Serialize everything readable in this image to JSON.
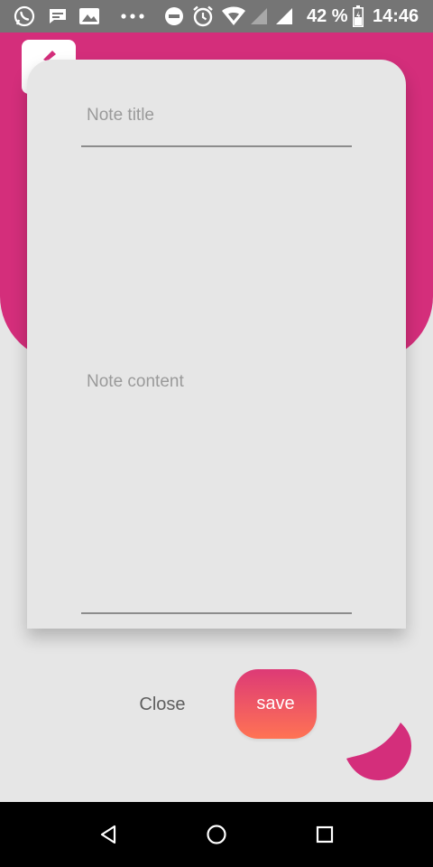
{
  "status_bar": {
    "icons": [
      "whatsapp-icon",
      "message-icon",
      "image-icon",
      "more-icon",
      "do-not-disturb-icon",
      "alarm-icon",
      "wifi-icon",
      "signal-icon",
      "signal-icon",
      "battery-icon"
    ],
    "battery": "42 %",
    "time": "14:46"
  },
  "header": {
    "color": "#d42e7b",
    "logo_icon": "edit-icon"
  },
  "dialog": {
    "title_placeholder": "Note title",
    "content_placeholder": "Note content",
    "close_label": "Close",
    "save_label": "save",
    "save_gradient": [
      "#dd3a76",
      "#ff7354"
    ]
  },
  "navbar": {
    "icons": [
      "back-icon",
      "home-icon",
      "recents-icon"
    ]
  }
}
